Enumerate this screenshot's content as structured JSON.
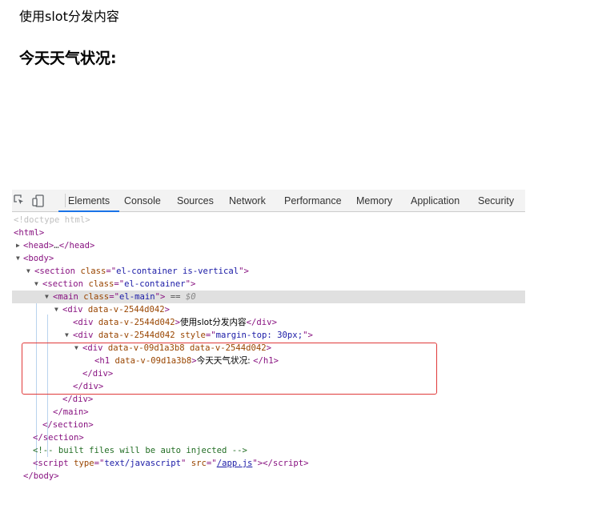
{
  "page": {
    "text": "使用slot分发内容",
    "heading": "今天天气状况:"
  },
  "devtools": {
    "tabs": [
      "Elements",
      "Console",
      "Sources",
      "Network",
      "Performance",
      "Memory",
      "Application",
      "Security"
    ],
    "active_tab": "Elements",
    "dom": {
      "doctype": "<!doctype html>",
      "html_open": "<html>",
      "head_tag": "head",
      "head_ellipsis": "…",
      "body_tag": "body",
      "section_outer_tag": "section",
      "section_outer_class": "el-container is-vertical",
      "section_inner_tag": "section",
      "section_inner_class": "el-container",
      "main_tag": "main",
      "main_class": "el-main",
      "eq_text": " == ",
      "dollar0": "$0",
      "div_tag": "div",
      "data_attr_parent": "data-v-2544d042",
      "div_text": "使用slot分发内容",
      "style_attr": "style",
      "style_value": "margin-top: 30px;",
      "data_attr_child": "data-v-09d1a3b8",
      "h1_tag": "h1",
      "h1_text": "今天天气状况: ",
      "comment": "<!-- built files will be auto injected -->",
      "script_tag": "script",
      "script_type_value": "text/javascript",
      "script_src": "/app.js",
      "class_attr": "class",
      "type_attr": "type",
      "src_attr": "src"
    }
  }
}
